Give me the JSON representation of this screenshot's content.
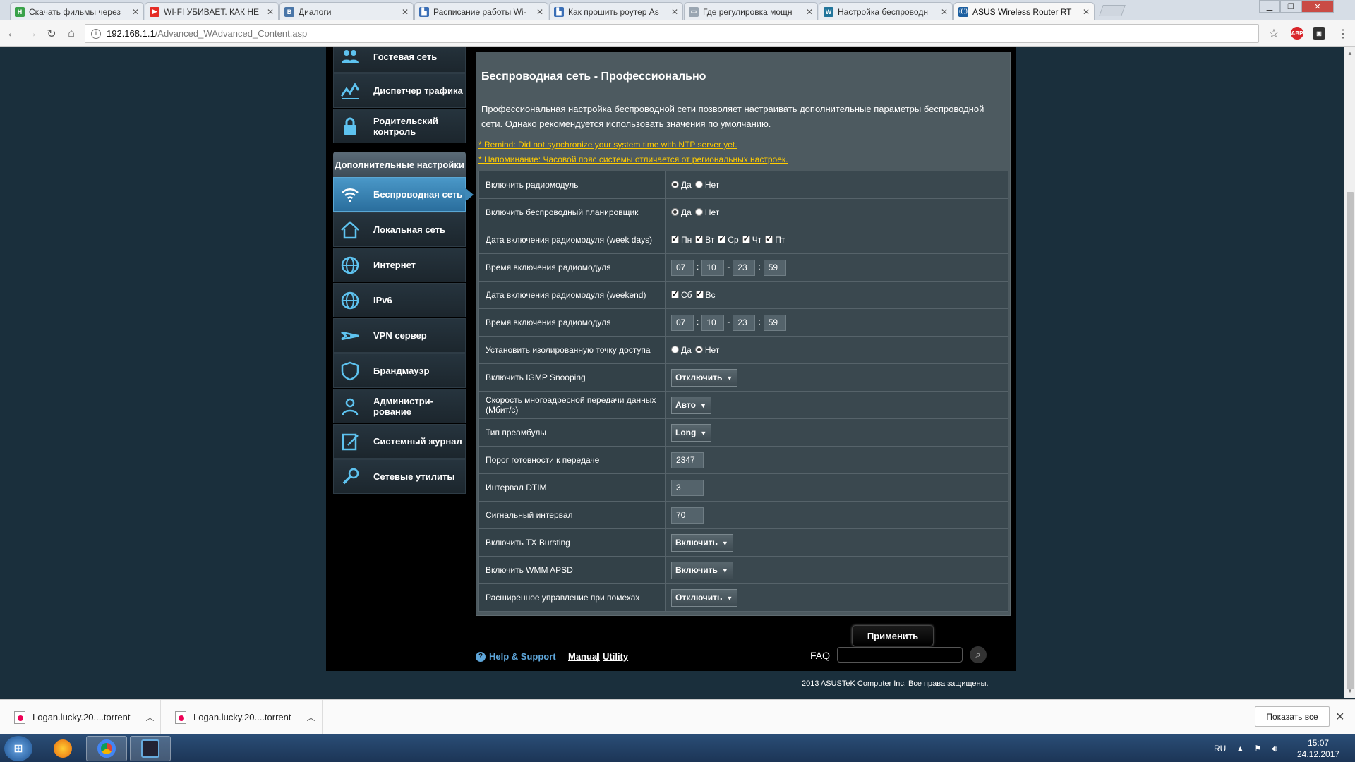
{
  "browser": {
    "tabs": [
      {
        "label": "Скачать фильмы через",
        "favicon_color": "#3aa24a",
        "favicon_glyph": "Н"
      },
      {
        "label": "WI-FI УБИВАЕТ. КАК НЕ",
        "favicon_color": "#e52d27",
        "favicon_glyph": "▶"
      },
      {
        "label": "Диалоги",
        "favicon_color": "#4a76a8",
        "favicon_glyph": "В"
      },
      {
        "label": "Расписание работы Wi-",
        "favicon_color": "#3b6fb6",
        "favicon_glyph": "▙"
      },
      {
        "label": "Как прошить роутер As",
        "favicon_color": "#3b6fb6",
        "favicon_glyph": "▙"
      },
      {
        "label": "Где регулировка мощн",
        "favicon_color": "#9aa6b2",
        "favicon_glyph": "▭"
      },
      {
        "label": "Настройка беспроводн",
        "favicon_color": "#21759b",
        "favicon_glyph": "W"
      },
      {
        "label": "ASUS Wireless Router RT",
        "favicon_color": "#1d5fa0",
        "favicon_glyph": "((·))"
      }
    ],
    "url_host": "192.168.1.1",
    "url_path": "/Advanced_WAdvanced_Content.asp"
  },
  "sidebar": {
    "top_items": [
      {
        "label": "Гостевая сеть",
        "icon": "guest-network-icon"
      },
      {
        "label": "Диспетчер трафика",
        "icon": "traffic-manager-icon"
      },
      {
        "label": "Родительский контроль",
        "icon": "parental-lock-icon"
      }
    ],
    "section_title": "Дополнительные настройки",
    "items": [
      {
        "label": "Беспроводная сеть",
        "icon": "wireless-icon"
      },
      {
        "label": "Локальная сеть",
        "icon": "home-lan-icon"
      },
      {
        "label": "Интернет",
        "icon": "globe-icon"
      },
      {
        "label": "IPv6",
        "icon": "ipv6-globe-icon"
      },
      {
        "label": "VPN сервер",
        "icon": "vpn-icon"
      },
      {
        "label": "Брандмауэр",
        "icon": "firewall-shield-icon"
      },
      {
        "label": "Администри-рование",
        "icon": "admin-user-icon"
      },
      {
        "label": "Системный журнал",
        "icon": "system-log-icon"
      },
      {
        "label": "Сетевые утилиты",
        "icon": "network-tools-icon"
      }
    ]
  },
  "main": {
    "title": "Беспроводная сеть - Профессионально",
    "description": "Профессиональная настройка беспроводной сети позволяет настраивать дополнительные параметры беспроводной сети. Однако рекомендуется использовать значения по умолчанию.",
    "remind_1": "* Remind: Did not synchronize your system time with NTP server yet.",
    "remind_2": "* Напоминание: Часовой пояс системы отличается от региональных настроек.",
    "rows": [
      {
        "label": "Включить радиомодуль",
        "type": "radio",
        "options": [
          "Да",
          "Нет"
        ],
        "selected": 0
      },
      {
        "label": "Включить беспроводный планировщик",
        "type": "radio",
        "options": [
          "Да",
          "Нет"
        ],
        "selected": 0
      },
      {
        "label": "Дата включения радиомодуля (week days)",
        "type": "check",
        "options": [
          "Пн",
          "Вт",
          "Ср",
          "Чт",
          "Пт"
        ]
      },
      {
        "label": "Время включения радиомодуля",
        "type": "time",
        "values": [
          "07",
          "10",
          "23",
          "59"
        ]
      },
      {
        "label": "Дата включения радиомодуля (weekend)",
        "type": "check",
        "options": [
          "Сб",
          "Вс"
        ]
      },
      {
        "label": "Время включения радиомодуля",
        "type": "time",
        "values": [
          "07",
          "10",
          "23",
          "59"
        ]
      },
      {
        "label": "Установить изолированную точку доступа",
        "type": "radio",
        "options": [
          "Да",
          "Нет"
        ],
        "selected": 1
      },
      {
        "label": "Включить IGMP Snooping",
        "type": "select",
        "value": "Отключить"
      },
      {
        "label": "Скорость многоадресной передачи данных (Мбит/с)",
        "type": "select",
        "value": "Авто"
      },
      {
        "label": "Тип преамбулы",
        "type": "select",
        "value": "Long"
      },
      {
        "label": "Порог готовности к передаче",
        "type": "text",
        "value": "2347"
      },
      {
        "label": "Интервал DTIM",
        "type": "text",
        "value": "3"
      },
      {
        "label": "Сигнальный интервал",
        "type": "text",
        "value": "70"
      },
      {
        "label": "Включить TX Bursting",
        "type": "select",
        "value": "Включить"
      },
      {
        "label": "Включить WMM APSD",
        "type": "select",
        "value": "Включить"
      },
      {
        "label": "Расширенное управление при помехах",
        "type": "select",
        "value": "Отключить"
      }
    ],
    "apply_label": "Применить"
  },
  "footer": {
    "help_label": "Help & Support",
    "manual_label": "Manual",
    "divider": "|",
    "utility_label": "Utility",
    "faq_label": "FAQ",
    "copyright": "2013  ASUSTeK Computer Inc. Все права защищены."
  },
  "downloads": {
    "items": [
      "Logan.lucky.20....torrent",
      "Logan.lucky.20....torrent"
    ],
    "show_all_label": "Показать все"
  },
  "taskbar": {
    "language": "RU",
    "time": "15:07",
    "date": "24.12.2017"
  },
  "colors": {
    "accent_active": "#3e88b8",
    "remind_yellow": "#ffcc00",
    "help_link_blue": "#5ea6da"
  }
}
